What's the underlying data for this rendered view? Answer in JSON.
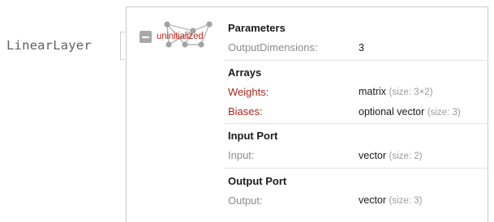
{
  "head": "LinearLayer",
  "icon": {
    "name": "network-graph-icon",
    "status": "uninitialized",
    "status_color": "#c22a22"
  },
  "sections": {
    "parameters": {
      "title": "Parameters",
      "rows": [
        {
          "key": "OutputDimensions:",
          "value": "3"
        }
      ]
    },
    "arrays": {
      "title": "Arrays",
      "rows": [
        {
          "key": "Weights:",
          "value": "matrix",
          "size": "(size: 3×2)"
        },
        {
          "key": "Biases:",
          "value": "optional vector",
          "size": "(size: 3)"
        }
      ]
    },
    "input_port": {
      "title": "Input Port",
      "rows": [
        {
          "key": "Input:",
          "value": "vector",
          "size": "(size: 2)"
        }
      ]
    },
    "output_port": {
      "title": "Output Port",
      "rows": [
        {
          "key": "Output:",
          "value": "vector",
          "size": "(size: 3)"
        }
      ]
    }
  }
}
